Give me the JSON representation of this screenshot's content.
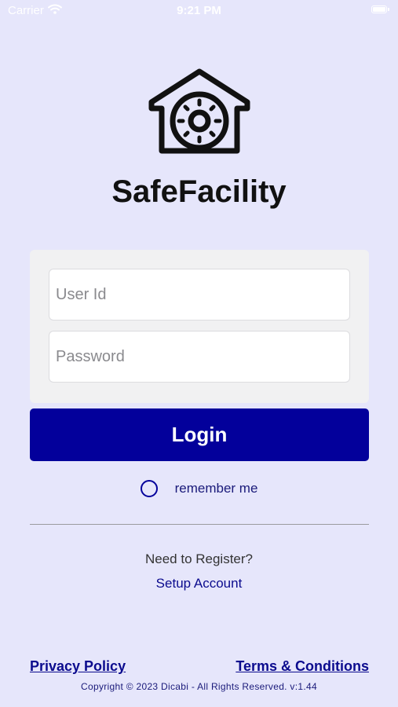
{
  "status_bar": {
    "carrier": "Carrier",
    "time": "9:21 PM",
    "icons": [
      "wifi-icon",
      "battery-icon"
    ]
  },
  "app": {
    "title": "SafeFacility",
    "logo_icon": "house-gear-icon"
  },
  "login_form": {
    "user_id_placeholder": "User Id",
    "user_id_value": "",
    "password_placeholder": "Password",
    "password_value": "",
    "login_label": "Login",
    "remember_label": "remember me",
    "remember_checked": false
  },
  "register": {
    "prompt": "Need to Register?",
    "link": "Setup Account"
  },
  "footer": {
    "privacy": "Privacy Policy",
    "terms": "Terms & Conditions",
    "copyright": "Copyright © 2023 Dicabi - All Rights Reserved. v:1.44"
  },
  "colors": {
    "background": "#e6e6fb",
    "primary": "#03009b",
    "link": "#0b0b8e",
    "card": "#f1f1f2"
  }
}
